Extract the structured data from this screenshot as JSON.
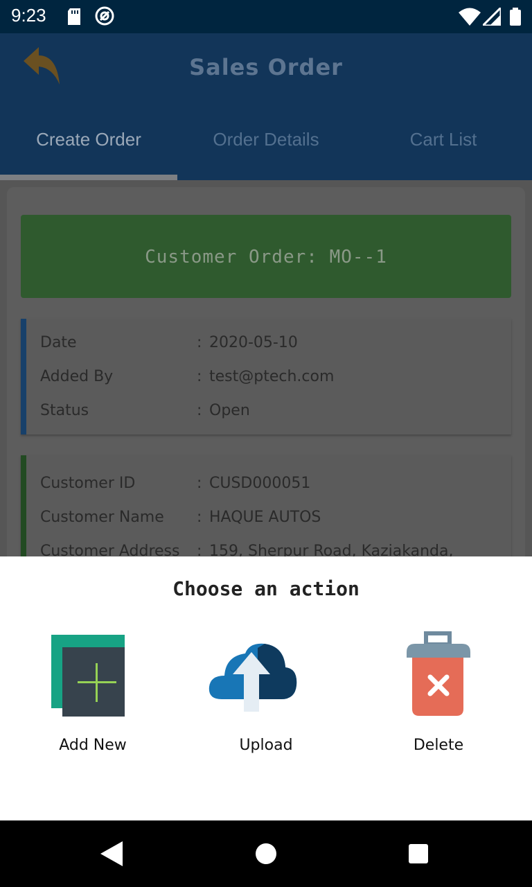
{
  "status_bar": {
    "time": "9:23",
    "icons": [
      "sd-card-icon",
      "cast-icon",
      "wifi-icon",
      "signal-icon",
      "battery-icon"
    ]
  },
  "app_bar": {
    "title": "Sales Order",
    "back_icon": "back-arrow-icon",
    "tabs": [
      {
        "label": "Create Order",
        "selected": true
      },
      {
        "label": "Order Details",
        "selected": false
      },
      {
        "label": "Cart List",
        "selected": false
      }
    ]
  },
  "order": {
    "banner": "Customer Order: MO--1",
    "info": [
      {
        "label": "Date",
        "value": "2020-05-10"
      },
      {
        "label": "Added By",
        "value": "test@ptech.com"
      },
      {
        "label": "Status",
        "value": "Open"
      }
    ],
    "customer": [
      {
        "label": "Customer ID",
        "value": "CUSD000051"
      },
      {
        "label": "Customer Name",
        "value": "HAQUE AUTOS"
      },
      {
        "label": "Customer Address",
        "value": "159, Sherpur Road, Kaziakanda,"
      }
    ],
    "separator": ":"
  },
  "sheet": {
    "title": "Choose an action",
    "actions": [
      {
        "label": "Add New",
        "icon": "add-new-icon"
      },
      {
        "label": "Upload",
        "icon": "upload-cloud-icon"
      },
      {
        "label": "Delete",
        "icon": "delete-trash-icon"
      }
    ]
  },
  "nav_bar": {
    "icons": [
      "back-triangle-icon",
      "home-circle-icon",
      "recents-square-icon"
    ]
  },
  "colors": {
    "status_bar": "#00253f",
    "app_bar_dimmed": "#123559",
    "banner_dimmed": "#2f5a2e",
    "sheet_bg": "#ffffff"
  }
}
